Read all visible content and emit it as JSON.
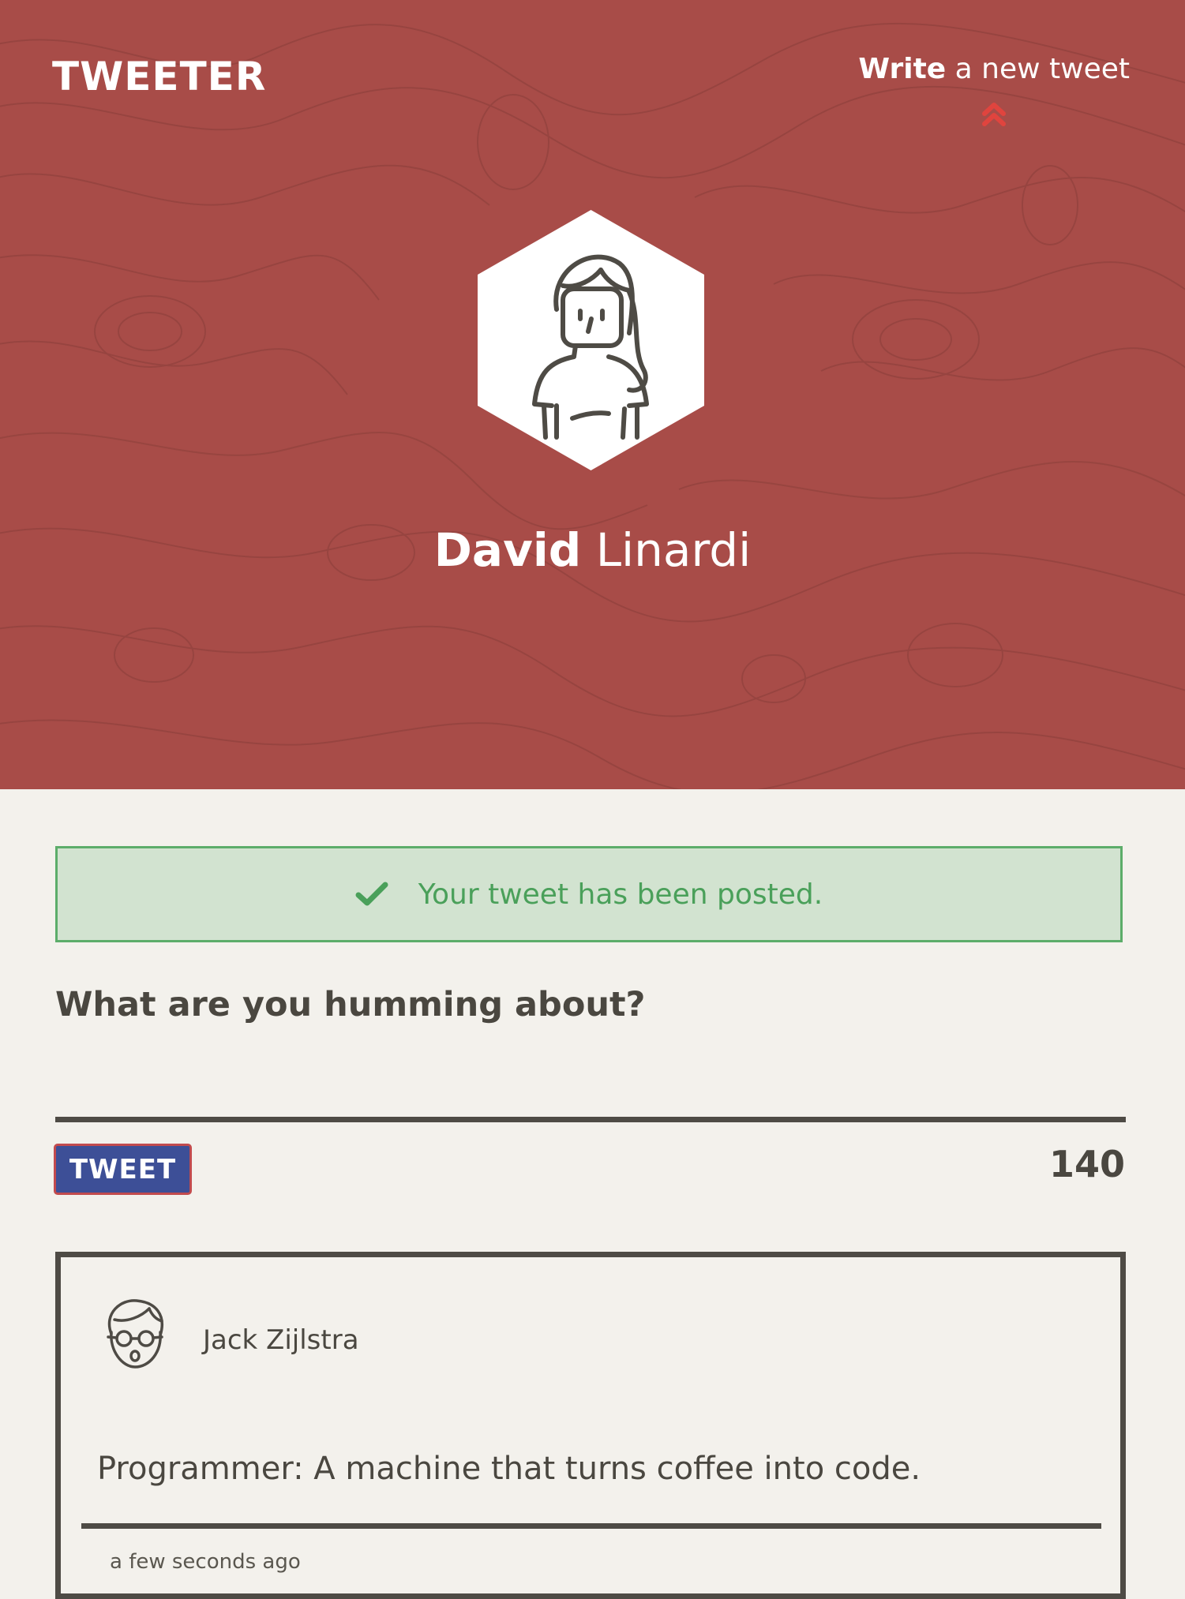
{
  "header": {
    "brand": "TWEETER",
    "compose_link_strong": "Write",
    "compose_link_rest": " a new tweet",
    "compose_link_icon": "double-chevron-up-icon"
  },
  "profile": {
    "first_name": "David",
    "last_name": " Linardi",
    "avatar_icon": "woman-avatar-icon"
  },
  "flash": {
    "icon": "check-icon",
    "message": "Your tweet has been posted."
  },
  "composer": {
    "label": "What are you humming about?",
    "input_value": "",
    "button_label": "TWEET",
    "counter": "140"
  },
  "tweets": [
    {
      "author": "Jack Zijlstra",
      "avatar_icon": "man-glasses-avatar-icon",
      "text": "Programmer: A machine that turns coffee into code.",
      "time": "a few seconds ago"
    }
  ],
  "colors": {
    "hero_background": "#a84c48",
    "page_background": "#f3f1ec",
    "flash_border": "#5cad6a",
    "flash_background": "#d2e3d0",
    "button_background": "#3d4f97",
    "button_border": "#c24b4e",
    "accent_arrow": "#e0443e"
  }
}
